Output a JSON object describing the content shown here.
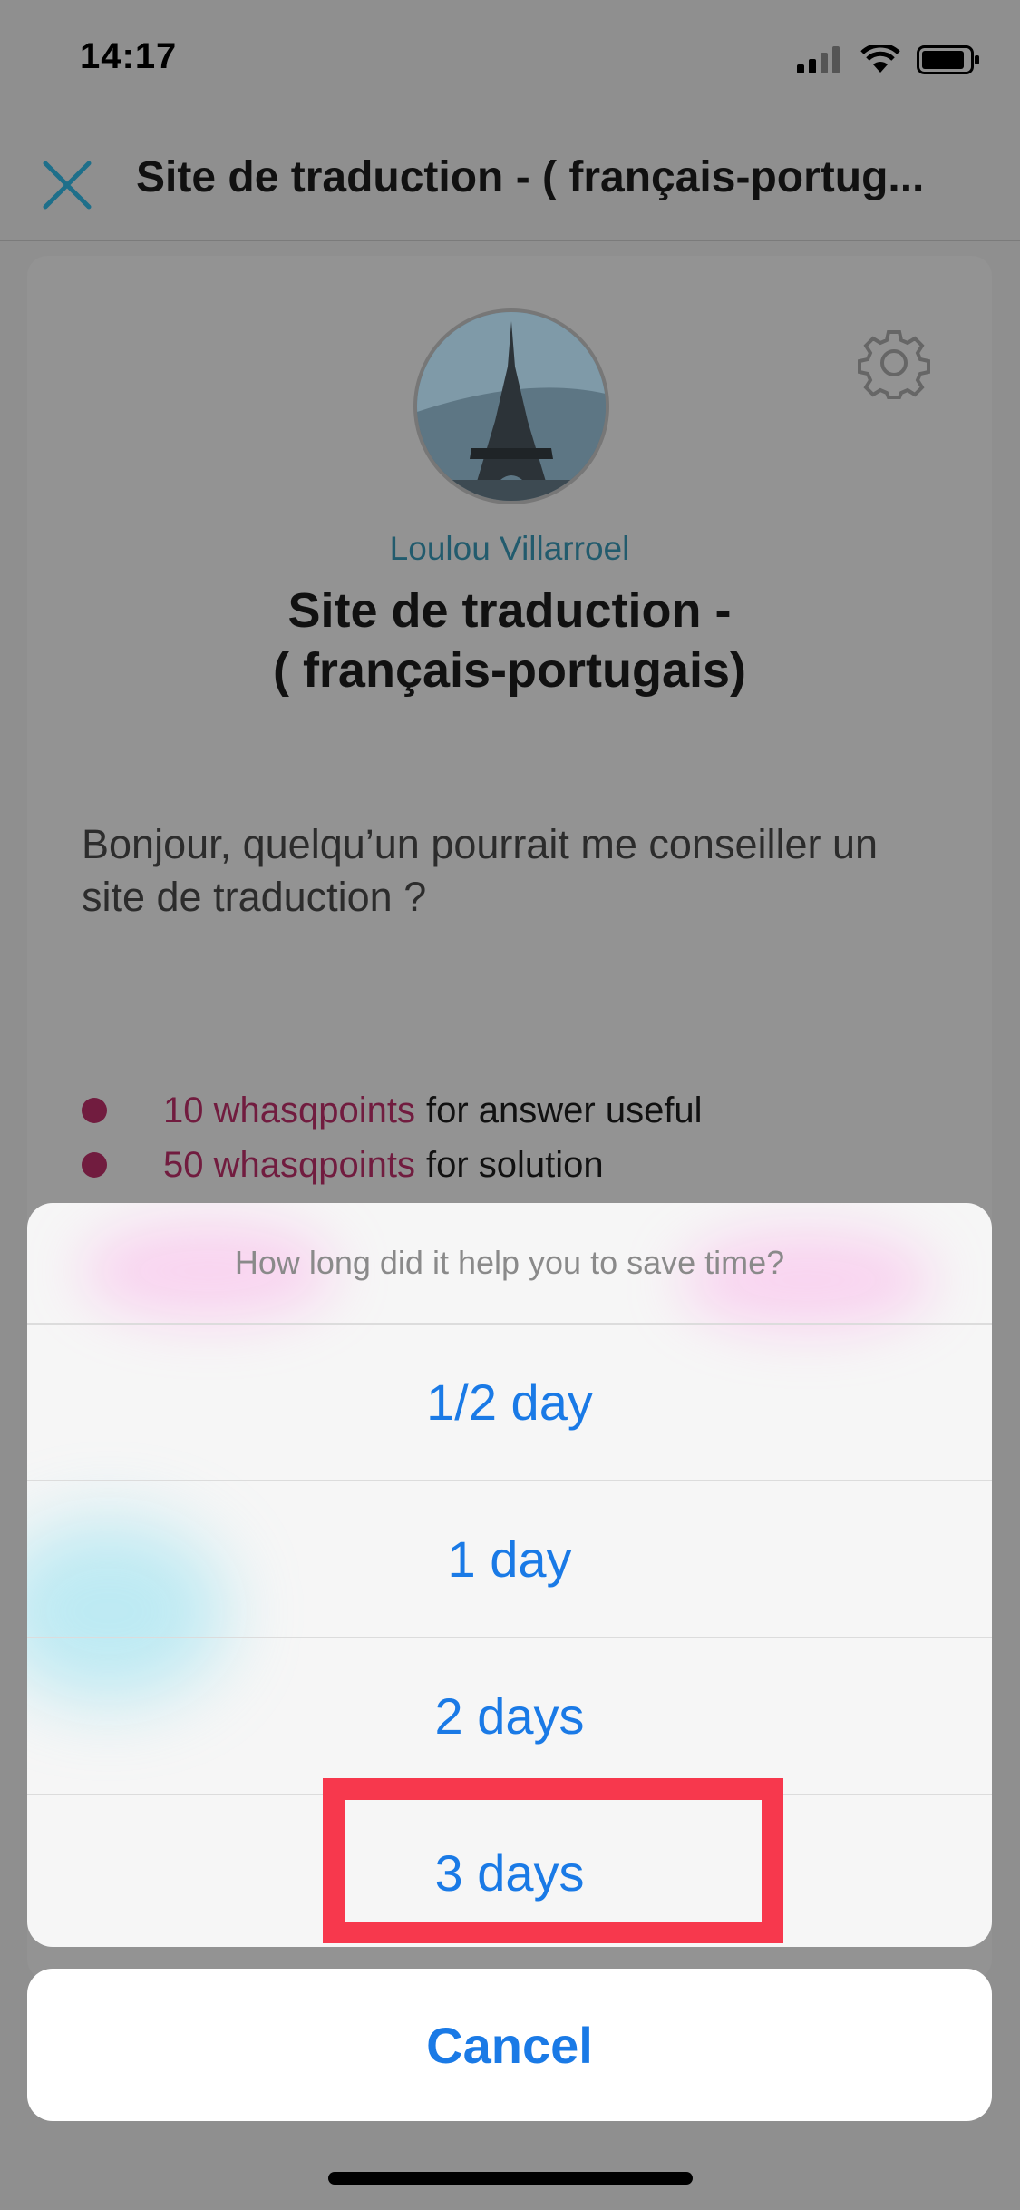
{
  "status_bar": {
    "time": "14:17"
  },
  "nav": {
    "title": "Site de traduction  - ( français-portug..."
  },
  "question": {
    "author": "Loulou Villarroel",
    "title_line1": "Site de traduction  -",
    "title_line2": "( français-portugais)",
    "body": "Bonjour, quelqu’un pourrait me conseiller un site de traduction ?",
    "points": [
      {
        "points": "10 whasqpoints",
        "text": "for answer useful"
      },
      {
        "points": "50 whasqpoints",
        "text": "for solution"
      }
    ]
  },
  "action_sheet": {
    "header": "How long did it help you to save time?",
    "options": [
      "1/2 day",
      "1 day",
      "2 days",
      "3 days"
    ],
    "cancel": "Cancel"
  },
  "colors": {
    "accent": "#1a7ae6",
    "points": "#711c3f",
    "highlight": "#f7384d",
    "author": "#225b6d"
  },
  "icons": [
    "close-icon",
    "gear-icon",
    "signal-icon",
    "wifi-icon",
    "battery-icon"
  ]
}
